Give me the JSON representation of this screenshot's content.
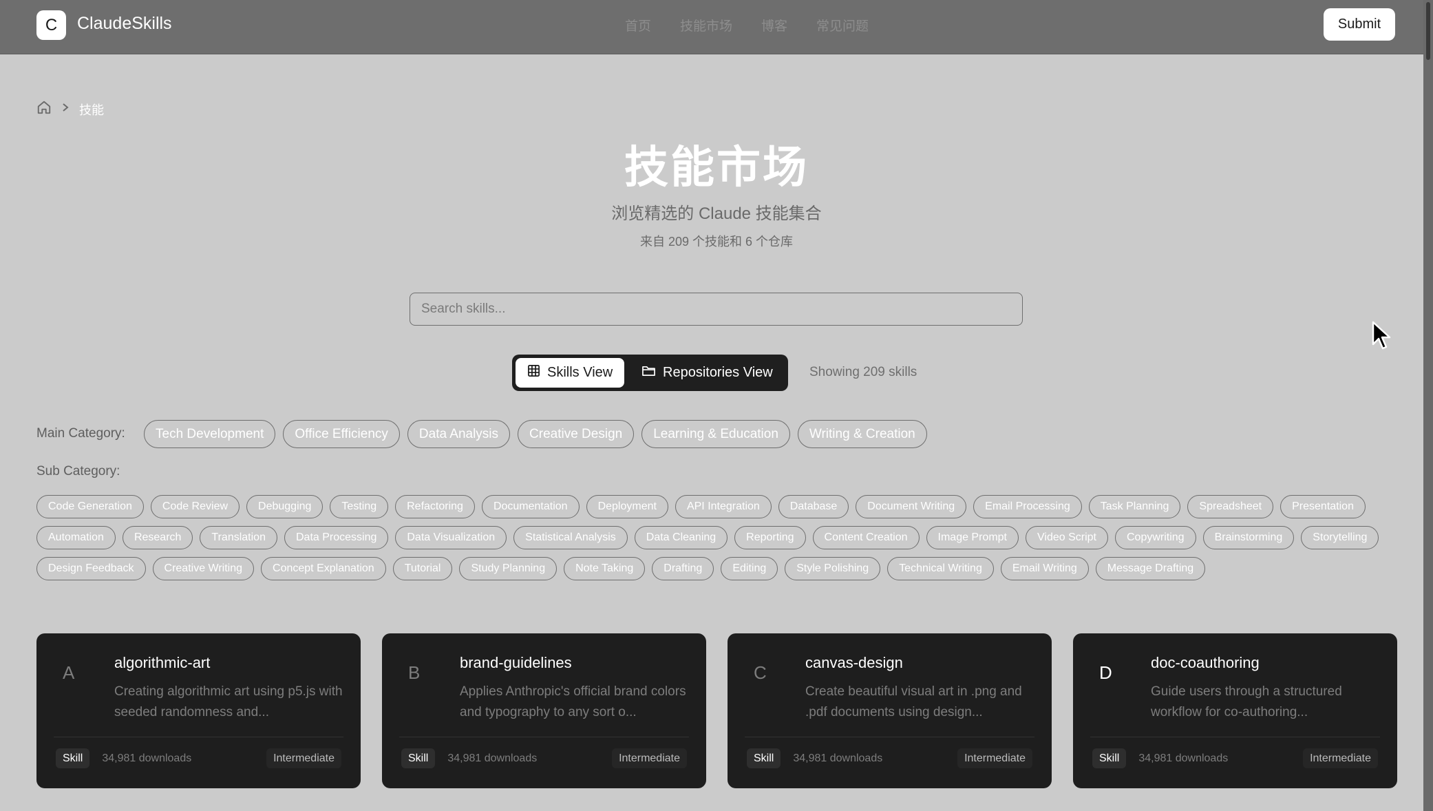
{
  "header": {
    "logo_letter": "C",
    "brand": "ClaudeSkills",
    "nav": [
      "首页",
      "技能市场",
      "博客",
      "常见问题"
    ],
    "submit_label": "Submit"
  },
  "breadcrumb": {
    "home_icon": "home-icon",
    "separator_icon": "chevron-right-icon",
    "current": "技能"
  },
  "hero": {
    "title": "技能市场",
    "subtitle": "浏览精选的 Claude 技能集合",
    "count_text": "来自 209 个技能和 6 个仓库"
  },
  "search": {
    "placeholder": "Search skills...",
    "value": ""
  },
  "view_toggle": {
    "skills_label": "Skills View",
    "skills_icon": "grid-icon",
    "repos_label": "Repositories View",
    "repos_icon": "folder-icon",
    "active": "skills"
  },
  "showing_text": "Showing 209 skills",
  "main_category": {
    "label": "Main Category:",
    "items": [
      "Tech Development",
      "Office Efficiency",
      "Data Analysis",
      "Creative Design",
      "Learning & Education",
      "Writing & Creation"
    ]
  },
  "sub_category": {
    "label": "Sub Category:",
    "items": [
      "Code Generation",
      "Code Review",
      "Debugging",
      "Testing",
      "Refactoring",
      "Documentation",
      "Deployment",
      "API Integration",
      "Database",
      "Document Writing",
      "Email Processing",
      "Task Planning",
      "Spreadsheet",
      "Presentation",
      "Automation",
      "Research",
      "Translation",
      "Data Processing",
      "Data Visualization",
      "Statistical Analysis",
      "Data Cleaning",
      "Reporting",
      "Content Creation",
      "Image Prompt",
      "Video Script",
      "Copywriting",
      "Brainstorming",
      "Storytelling",
      "Design Feedback",
      "Creative Writing",
      "Concept Explanation",
      "Tutorial",
      "Study Planning",
      "Note Taking",
      "Drafting",
      "Editing",
      "Style Polishing",
      "Technical Writing",
      "Email Writing",
      "Message Drafting"
    ]
  },
  "cards": [
    {
      "letter": "A",
      "title": "algorithmic-art",
      "description": "Creating algorithmic art using p5.js with seeded randomness and...",
      "badge": "Skill",
      "downloads": "34,981 downloads",
      "level": "Intermediate"
    },
    {
      "letter": "B",
      "title": "brand-guidelines",
      "description": "Applies Anthropic's official brand colors and typography to any sort o...",
      "badge": "Skill",
      "downloads": "34,981 downloads",
      "level": "Intermediate"
    },
    {
      "letter": "C",
      "title": "canvas-design",
      "description": "Create beautiful visual art in .png and .pdf documents using design...",
      "badge": "Skill",
      "downloads": "34,981 downloads",
      "level": "Intermediate"
    },
    {
      "letter": "D",
      "title": "doc-coauthoring",
      "description": "Guide users through a structured workflow for co-authoring...",
      "badge": "Skill",
      "downloads": "34,981 downloads",
      "level": "Intermediate"
    }
  ]
}
